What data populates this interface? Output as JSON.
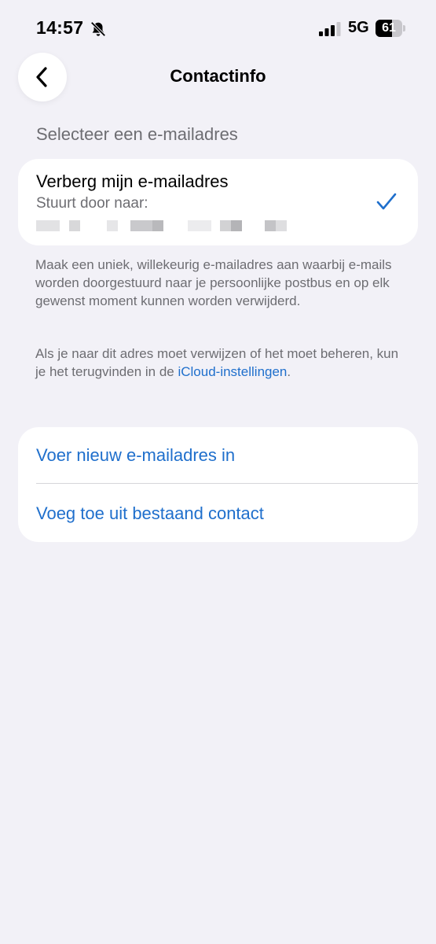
{
  "status_bar": {
    "time": "14:57",
    "network": "5G",
    "battery_level": 61,
    "battery_text": "61",
    "icons": [
      "bell-slash-icon",
      "signal-bars-icon",
      "battery-icon"
    ]
  },
  "nav": {
    "back_icon": "chevron-left-icon",
    "title": "Contactinfo"
  },
  "section": {
    "header": "Selecteer een e-mailadres"
  },
  "hide_option": {
    "title": "Verberg mijn e-mailadres",
    "subtitle": "Stuurt door naar:",
    "selected": true,
    "check_icon": "checkmark-icon"
  },
  "footer": {
    "paragraph_1": "Maak een uniek, willekeurig e-mailadres aan waarbij e-mails worden doorgestuurd naar je persoonlijke postbus en op elk gewenst moment kunnen worden verwijderd.",
    "paragraph_2_prefix": "Als je naar dit adres moet verwijzen of het moet beheren, kun je het terugvinden in de ",
    "paragraph_2_link": "iCloud-instellingen",
    "paragraph_2_suffix": "."
  },
  "actions": {
    "enter_new_email": "Voer nieuw e-mailadres in",
    "add_from_contact": "Voeg toe uit bestaand contact"
  },
  "colors": {
    "background": "#f2f1f7",
    "accent": "#1f6fcc",
    "secondary_text": "#6d6d72",
    "card": "#ffffff"
  }
}
